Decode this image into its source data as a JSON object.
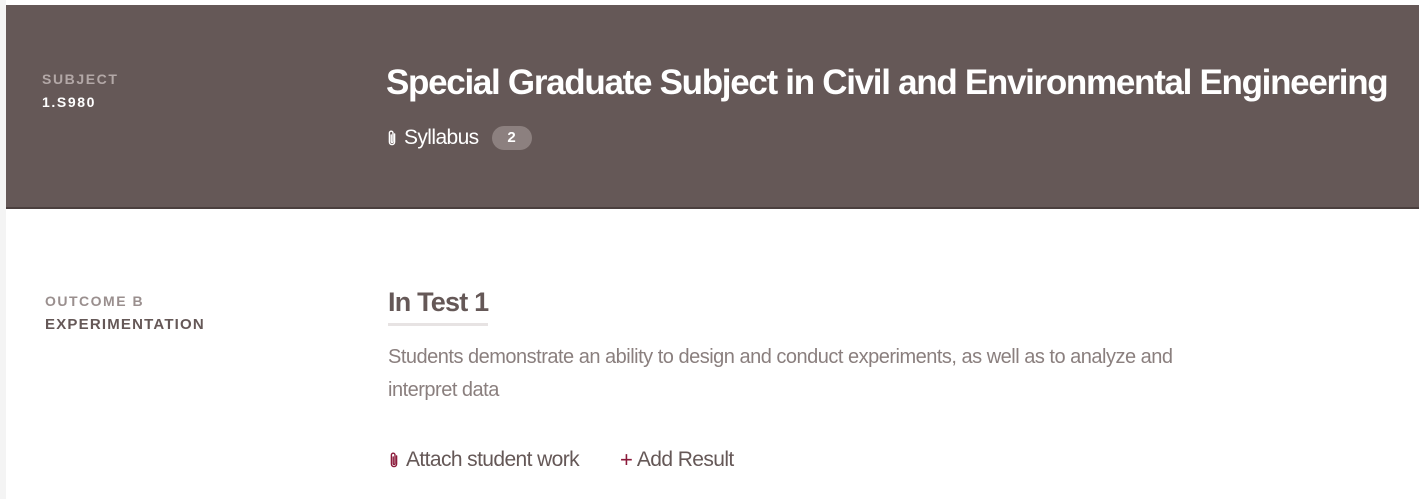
{
  "subject": {
    "kicker": "SUBJECT",
    "code": "1.S980",
    "title": "Special Graduate Subject in Civil and Environmental Engineering",
    "syllabus_label": "Syllabus",
    "syllabus_count": "2"
  },
  "outcome": {
    "kicker": "OUTCOME B",
    "name": "EXPERIMENTATION",
    "result_title": "In Test 1",
    "description": "Students demonstrate an ability to design and conduct experiments, as well as to analyze and interpret data",
    "actions": {
      "attach_label": "Attach student work",
      "add_result_label": "Add Result",
      "add_result_icon": "+"
    }
  },
  "colors": {
    "header_background": "#655857",
    "accent": "#8b1a3a",
    "muted_text": "#8a7f7e"
  },
  "icons": {
    "syllabus": "paperclip-icon",
    "attach": "paperclip-icon",
    "add": "plus-icon"
  }
}
